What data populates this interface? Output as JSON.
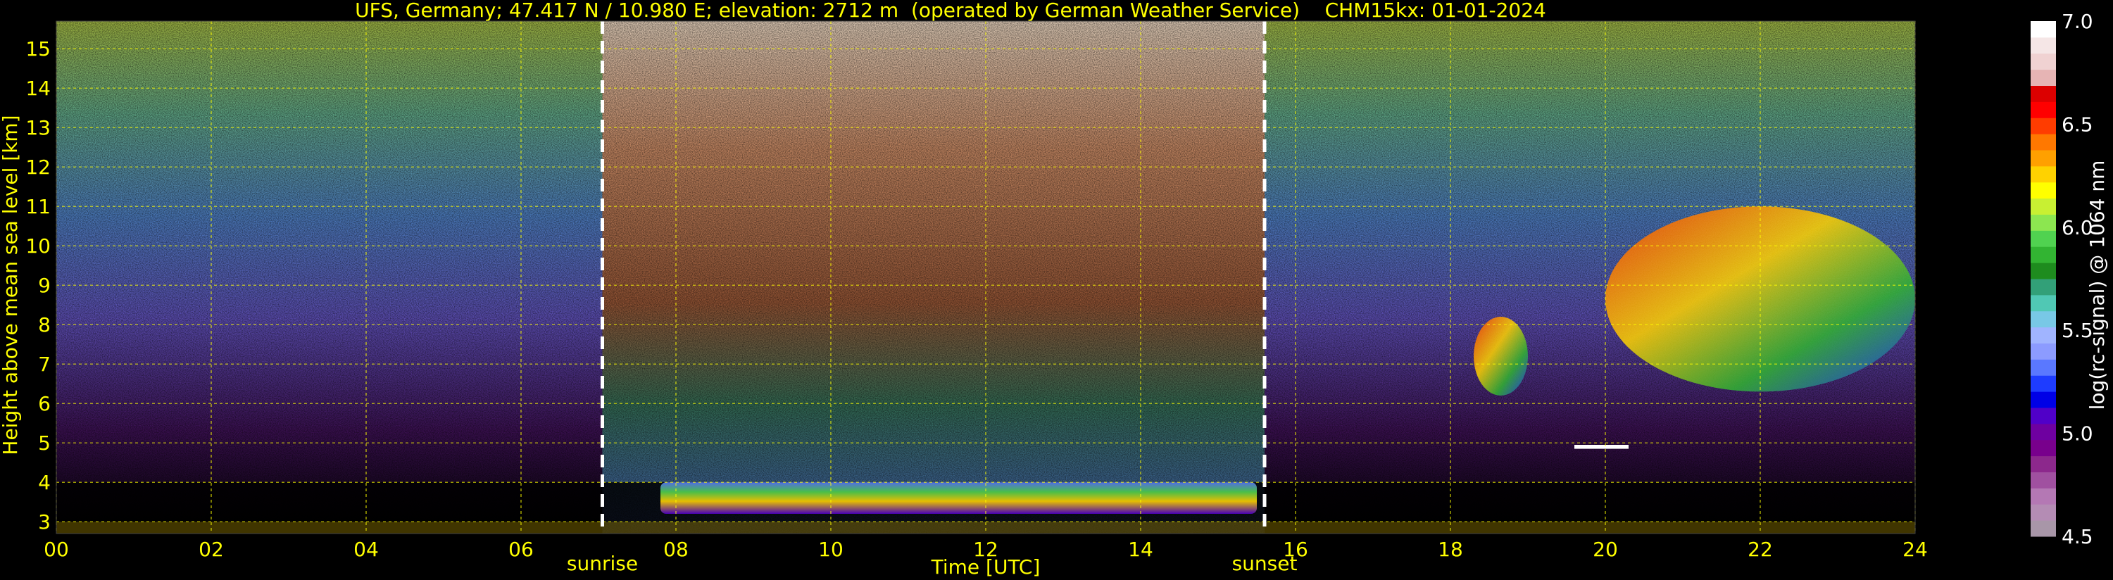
{
  "chart_data": {
    "type": "heatmap",
    "title": "UFS, Germany; 47.417 N / 10.980 E; elevation: 2712 m  (operated by German Weather Service)    CHM15kx: 01-01-2024",
    "xlabel": "Time [UTC]",
    "ylabel": "Height above mean sea level [km]",
    "xlim": [
      0,
      24
    ],
    "ylim": [
      2.7,
      15.7
    ],
    "x_ticks": [
      "00",
      "02",
      "04",
      "06",
      "08",
      "10",
      "12",
      "14",
      "16",
      "18",
      "20",
      "22",
      "24"
    ],
    "y_ticks": [
      "3",
      "4",
      "5",
      "6",
      "7",
      "8",
      "9",
      "10",
      "11",
      "12",
      "13",
      "14",
      "15"
    ],
    "grid": true,
    "vertical_markers": [
      {
        "label": "sunrise",
        "x": 7.05
      },
      {
        "label": "sunset",
        "x": 15.6
      }
    ],
    "colorbar": {
      "label": "log(rc-signal) @ 1064 nm",
      "range": [
        4.5,
        7.0
      ],
      "ticks": [
        "4.5",
        "5.0",
        "5.5",
        "6.0",
        "6.5",
        "7.0"
      ],
      "colors": [
        "#a896a8",
        "#b48cb4",
        "#b478b4",
        "#a050a0",
        "#8c288c",
        "#78008c",
        "#6e00a0",
        "#5000c8",
        "#0000e6",
        "#1e3cff",
        "#5a78ff",
        "#8c9bff",
        "#a0b4ff",
        "#78c8e6",
        "#50c8b4",
        "#32a078",
        "#1e8c1e",
        "#32b432",
        "#50d250",
        "#8ce650",
        "#c8f032",
        "#ffff00",
        "#ffd200",
        "#ffa000",
        "#ff7800",
        "#ff3c00",
        "#ff0000",
        "#dc0000",
        "#e6b4b4",
        "#f0d2d2",
        "#f5e6e6",
        "#ffffff"
      ]
    },
    "features": [
      {
        "type": "boundary-layer",
        "x": [
          7.8,
          15.5
        ],
        "y": [
          3.2,
          4.0
        ]
      },
      {
        "type": "cloud",
        "x": [
          18.3,
          19.0
        ],
        "y": [
          6.2,
          8.2
        ]
      },
      {
        "type": "cloud",
        "x": [
          20.0,
          24.0
        ],
        "y": [
          6.3,
          11.0
        ]
      },
      {
        "type": "thin-layer",
        "x": [
          19.6,
          20.3
        ],
        "y": [
          4.85,
          4.95
        ]
      }
    ]
  }
}
